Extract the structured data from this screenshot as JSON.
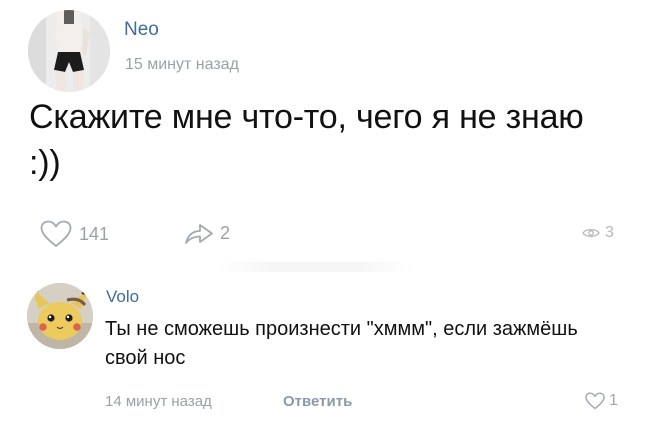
{
  "post": {
    "author": "Neo",
    "time": "15 минут назад",
    "text": "Скажите мне что-то, чего я не знаю :))",
    "likes": "141",
    "shares": "2",
    "views": "3",
    "avatar_icon": "person-photo-avatar"
  },
  "comment": {
    "author": "Volo",
    "text": "Ты не сможешь произнести \"хммм\", если зажмёшь свой нос",
    "time": "14 минут назад",
    "reply_label": "Ответить",
    "likes": "1",
    "avatar_icon": "pikachu-avatar"
  },
  "colors": {
    "link": "#3f6d9c",
    "muted": "#9aa1a9",
    "text": "#111111"
  },
  "icons": [
    "heart-icon",
    "share-arrow-icon",
    "eye-icon"
  ]
}
